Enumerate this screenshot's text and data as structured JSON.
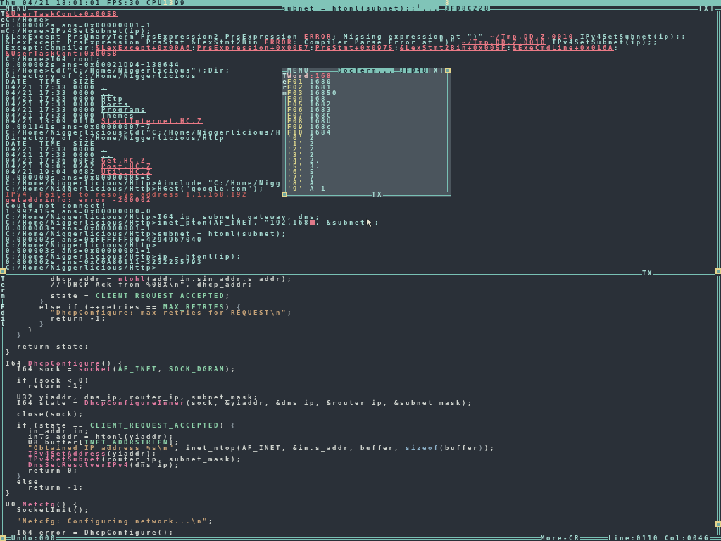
{
  "top_bar": {
    "clock": "Thu 04/21 18:01:01",
    "fps": "FPS:30",
    "cpu_label": "CPU",
    "cpu_cores": [
      {
        "value": "13",
        "color": "#f4e4b4"
      },
      {
        "value": "99",
        "color": "#1c2830"
      }
    ],
    "indicator": "8"
  },
  "terminal": {
    "menu": "MENU",
    "title": "subnet = htonl(subnet);;└...",
    "task_id": "3FD8C228",
    "close": "[X]",
    "side_label": "Term",
    "footer": "TX",
    "lines": [
      {
        "parts": [
          {
            "text": "&UserTaskCont+0x005B",
            "kind": "link"
          }
        ]
      },
      {
        "parts": [
          {
            "text": "C:/Home>",
            "kind": "text"
          }
        ]
      },
      {
        "parts": [
          {
            "text": "0.000002s ans=0x00000001=1",
            "kind": "text"
          }
        ]
      },
      {
        "parts": [
          {
            "text": "C:/Home>IPv4SetSubnet(ip);",
            "kind": "text"
          }
        ]
      },
      {
        "parts": [
          {
            "text": "&LexExcept PrsUnaryTerm PrsExpression2 PrsExpression ",
            "kind": "text"
          },
          {
            "text": "ERROR",
            "kind": "error"
          },
          {
            "text": ": Missing expression at \")\" ",
            "kind": "text"
          },
          {
            "text": "~/Tmp.DD.Z.0010",
            "kind": "link"
          },
          {
            "text": " IPv4SetSubnet(ip);;",
            "kind": "text"
          }
        ]
      },
      {
        "parts": [
          {
            "text": "&LexExcept PrsExpression PrsStmt &LexStmt2Bin ",
            "kind": "text"
          },
          {
            "text": "ERROR",
            "kind": "error"
          },
          {
            "text": ": Compiler Parse Error at \")\" ",
            "kind": "text"
          },
          {
            "text": "~/Tmp.DD.Z.0010",
            "kind": "link"
          },
          {
            "text": " IPv4SetSubnet(ip);;",
            "kind": "text"
          }
        ]
      },
      {
        "parts": [
          {
            "text": "Except:Compiler:",
            "kind": "text"
          },
          {
            "text": "&LexExcept+0x00A6",
            "kind": "link"
          },
          {
            "text": ":",
            "kind": "text"
          },
          {
            "text": "PrsExpression+0x00E7",
            "kind": "link"
          },
          {
            "text": ":",
            "kind": "text"
          },
          {
            "text": "PrsStmt+0x0975",
            "kind": "link"
          },
          {
            "text": ":",
            "kind": "text"
          },
          {
            "text": "&LexStmt2Bin+0x005F",
            "kind": "link"
          },
          {
            "text": ":",
            "kind": "text"
          },
          {
            "text": "&ExeCmdLine+0x016A",
            "kind": "link"
          },
          {
            "text": ":",
            "kind": "text"
          }
        ]
      },
      {
        "parts": [
          {
            "text": "&UserTaskCont+0x005B",
            "kind": "link"
          }
        ]
      },
      {
        "parts": [
          {
            "text": "C:/Home>I64 rout;",
            "kind": "text"
          }
        ]
      },
      {
        "parts": [
          {
            "text": "0.000002s ans=0x00021D94=138644",
            "kind": "text"
          }
        ]
      },
      {
        "parts": [
          {
            "text": "C:/Home>Cd(\"C:/Home/Niggerlicious\");Dir;",
            "kind": "text"
          }
        ]
      },
      {
        "parts": [
          {
            "text": "Directory of C:/Home/Niggerlicious",
            "kind": "text"
          }
        ]
      },
      {
        "parts": [
          {
            "text": "DATE_ TIME_ SIZE",
            "kind": "text"
          }
        ]
      },
      {
        "parts": [
          {
            "text": "04/21 17:33 0000 ",
            "kind": "text"
          },
          {
            "text": ".",
            "kind": "dir"
          }
        ]
      },
      {
        "parts": [
          {
            "text": "04/21 17:33 0000 ",
            "kind": "text"
          },
          {
            "text": "..",
            "kind": "dir"
          }
        ]
      },
      {
        "parts": [
          {
            "text": "04/21 17:33 0000 ",
            "kind": "text"
          },
          {
            "text": "Http",
            "kind": "dir"
          }
        ]
      },
      {
        "parts": [
          {
            "text": "04/21 17:33 0000 ",
            "kind": "text"
          },
          {
            "text": "Ports",
            "kind": "dir"
          }
        ]
      },
      {
        "parts": [
          {
            "text": "04/21 17:33 0000 ",
            "kind": "text"
          },
          {
            "text": "Programs",
            "kind": "dir"
          }
        ]
      },
      {
        "parts": [
          {
            "text": "04/21 17:33 0000 ",
            "kind": "text"
          },
          {
            "text": "Themes",
            "kind": "dir"
          }
        ]
      },
      {
        "parts": [
          {
            "text": "04/21 13:09 011D ",
            "kind": "text"
          },
          {
            "text": "StartInternet.HC.Z",
            "kind": "link"
          }
        ]
      },
      {
        "parts": [
          {
            "text": "0.001141s ans=0x00000007=7",
            "kind": "text"
          }
        ]
      },
      {
        "parts": [
          {
            "text": "C:/Home/Niggerlicious>Cd(\"C:/Home/Niggerlicious/H",
            "kind": "text"
          }
        ]
      },
      {
        "parts": [
          {
            "text": "Directory of C:/Home/Niggerlicious/Http",
            "kind": "text"
          }
        ]
      },
      {
        "parts": [
          {
            "text": "DATE_ TIME_ SIZE",
            "kind": "text"
          }
        ]
      },
      {
        "parts": [
          {
            "text": "04/21 17:33 0000 ",
            "kind": "text"
          },
          {
            "text": ".",
            "kind": "dir"
          }
        ]
      },
      {
        "parts": [
          {
            "text": "04/21 17:33 0000 ",
            "kind": "text"
          },
          {
            "text": "..",
            "kind": "dir"
          }
        ]
      },
      {
        "parts": [
          {
            "text": "04/21 17:36 00F3 ",
            "kind": "text"
          },
          {
            "text": "Get.HC.Z",
            "kind": "link"
          }
        ]
      },
      {
        "parts": [
          {
            "text": "04/21 19:05 02A2 ",
            "kind": "text"
          },
          {
            "text": "Post.HC.Z",
            "kind": "link"
          }
        ]
      },
      {
        "parts": [
          {
            "text": "04/21 19:04 0682 ",
            "kind": "text"
          },
          {
            "text": "Util.HC.Z",
            "kind": "link"
          }
        ]
      },
      {
        "parts": [
          {
            "text": "0.000900s ans=0x00000005=5",
            "kind": "text"
          }
        ]
      },
      {
        "parts": [
          {
            "text": "C:/Home/Niggerlicious/Http>#include \"C:/Home/Nigg",
            "kind": "text"
          }
        ]
      },
      {
        "parts": [
          {
            "text": "C:/Home/Niggerlicious/Http>HGet(\"google.com\");",
            "kind": "text"
          }
        ]
      },
      {
        "parts": [
          {
            "text": "IPv4: Failed to resolve address 1.1.168.192",
            "kind": "warn"
          }
        ]
      },
      {
        "parts": [
          {
            "text": "getaddrinfo: error -200002",
            "kind": "error"
          }
        ]
      },
      {
        "parts": [
          {
            "text": "Could not connect!",
            "kind": "text"
          }
        ]
      },
      {
        "parts": [
          {
            "text": "1.997415s ans=0x00000000=0",
            "kind": "text"
          }
        ]
      },
      {
        "parts": [
          {
            "text": "C:/Home/Niggerlicious/Http>I64 ip, subnet, gateway, dns;",
            "kind": "text"
          }
        ]
      },
      {
        "parts": [
          {
            "text": "C:/Home/Niggerlicious/Http>inet_pton(AF_INET, \"192.168",
            "kind": "text"
          },
          {
            "kind": "cursor"
          },
          {
            "text": ", &subnet",
            "kind": "text"
          },
          {
            "kind": "pointer"
          },
          {
            "text": ";",
            "kind": "text"
          }
        ]
      },
      {
        "parts": [
          {
            "text": "0.000003s ans=0x00000001=1",
            "kind": "text"
          }
        ]
      },
      {
        "parts": [
          {
            "text": "C:/Home/Niggerlicious/Http>subnet = htonl(subnet);",
            "kind": "text"
          }
        ]
      },
      {
        "parts": [
          {
            "text": "0.000002s ans=0xFFFFFF00=4294967040",
            "kind": "text"
          }
        ]
      },
      {
        "parts": [
          {
            "text": "C:/Home/Niggerlicious/Http>",
            "kind": "text"
          }
        ]
      },
      {
        "parts": [
          {
            "text": "0.000003s ans=0x00000001=1",
            "kind": "text"
          }
        ]
      },
      {
        "parts": [
          {
            "text": "C:/Home/Niggerlicious/Http>ip = htonl(ip);",
            "kind": "text"
          }
        ]
      },
      {
        "parts": [
          {
            "text": "0.000002s ans=0xC0A80111=3232235793",
            "kind": "text"
          }
        ]
      },
      {
        "parts": [
          {
            "text": "C:/Home/Niggerlicious/Http>",
            "kind": "text"
          }
        ]
      }
    ]
  },
  "doc_popup": {
    "menu": "MENU",
    "title": "DocTerm...",
    "task_id": "3FD48",
    "close": "[X]",
    "side_label": "Term",
    "footer": "TX",
    "word": {
      "label": "Word",
      "value": ":168"
    },
    "rows": [
      {
        "key": "F01",
        "value": "1680"
      },
      {
        "key": "F02",
        "value": "1681"
      },
      {
        "key": "F03",
        "value": "16850"
      },
      {
        "key": "F04",
        "value": "168"
      },
      {
        "key": "F05",
        "value": "1682"
      },
      {
        "key": "F06",
        "value": "1683"
      },
      {
        "key": "F07",
        "value": "168C"
      },
      {
        "key": "F08",
        "value": "168U"
      },
      {
        "key": "F09",
        "value": "168c"
      },
      {
        "key": "F10",
        "value": "1684"
      },
      {
        "key": "'0'",
        "value": "2"
      },
      {
        "key": "'1'",
        "value": "2"
      },
      {
        "key": "'2'",
        "value": "2"
      },
      {
        "key": "'3'",
        "value": "2"
      },
      {
        "key": "'4'",
        "value": "2."
      },
      {
        "key": "'5'",
        "value": "3."
      },
      {
        "key": "'6'",
        "value": "5"
      },
      {
        "key": "'7'",
        "value": "7"
      },
      {
        "key": "'8'",
        "value": "A"
      },
      {
        "key": "'9'",
        "value": "A 1"
      }
    ]
  },
  "editor": {
    "side_labels": [
      "Term",
      "Edit"
    ],
    "lines": [
      {
        "kind": "code",
        "parts": [
          {
            "text": "        dhcp_addr = ",
            "kind": "plain"
          },
          {
            "text": "ntohl",
            "kind": "func"
          },
          {
            "text": "(addr_in.sin_addr.s_addr);",
            "kind": "plain"
          }
        ]
      },
      {
        "kind": "code",
        "parts": [
          {
            "text": "        //\"DHCP Ack from %08X\\n\", dhcp_addr;",
            "kind": "plain"
          }
        ]
      },
      {
        "kind": "blank"
      },
      {
        "kind": "code",
        "parts": [
          {
            "text": "        state = ",
            "kind": "plain"
          },
          {
            "text": "CLIENT_REQUEST_ACCEPTED",
            "kind": "const"
          },
          {
            "text": ";",
            "kind": "plain"
          }
        ]
      },
      {
        "kind": "code",
        "parts": [
          {
            "text": "      }",
            "kind": "dim"
          }
        ]
      },
      {
        "kind": "code",
        "parts": [
          {
            "text": "      else if (++retries == ",
            "kind": "plain"
          },
          {
            "text": "MAX_RETRIES",
            "kind": "const"
          },
          {
            "text": ") ",
            "kind": "plain"
          },
          {
            "text": "{",
            "kind": "dim"
          }
        ]
      },
      {
        "kind": "code",
        "parts": [
          {
            "text": "        \"DhcpConfigure: max retries for REQUEST\\n\"",
            "kind": "string"
          },
          {
            "text": ";",
            "kind": "plain"
          }
        ]
      },
      {
        "kind": "code",
        "parts": [
          {
            "text": "        return -1;",
            "kind": "plain"
          }
        ]
      },
      {
        "kind": "code",
        "parts": [
          {
            "text": "      }",
            "kind": "dim"
          }
        ]
      },
      {
        "kind": "code",
        "parts": [
          {
            "text": "    }",
            "kind": "plain"
          }
        ]
      },
      {
        "kind": "code",
        "parts": [
          {
            "text": "  }",
            "kind": "dim"
          }
        ]
      },
      {
        "kind": "blank"
      },
      {
        "kind": "code",
        "parts": [
          {
            "text": "  return state;",
            "kind": "plain"
          }
        ]
      },
      {
        "kind": "code",
        "parts": [
          {
            "text": "}",
            "kind": "plain"
          }
        ]
      },
      {
        "kind": "blank"
      },
      {
        "kind": "code",
        "parts": [
          {
            "text": "I64 ",
            "kind": "plain"
          },
          {
            "text": "DhcpConfigure",
            "kind": "func"
          },
          {
            "text": "() {",
            "kind": "plain"
          }
        ]
      },
      {
        "kind": "code",
        "parts": [
          {
            "text": "  I64 sock = ",
            "kind": "plain"
          },
          {
            "text": "socket",
            "kind": "func"
          },
          {
            "text": "(",
            "kind": "plain"
          },
          {
            "text": "AF_INET",
            "kind": "const"
          },
          {
            "text": ", ",
            "kind": "plain"
          },
          {
            "text": "SOCK_DGRAM",
            "kind": "const"
          },
          {
            "text": ");",
            "kind": "plain"
          }
        ]
      },
      {
        "kind": "blank"
      },
      {
        "kind": "code",
        "parts": [
          {
            "text": "  if (sock < 0)",
            "kind": "plain"
          }
        ]
      },
      {
        "kind": "code",
        "parts": [
          {
            "text": "    return -1;",
            "kind": "plain"
          }
        ]
      },
      {
        "kind": "blank"
      },
      {
        "kind": "code",
        "parts": [
          {
            "text": "  U32 yiaddr, dns_ip, router_ip, subnet_mask;",
            "kind": "plain"
          }
        ]
      },
      {
        "kind": "code",
        "parts": [
          {
            "text": "  I64 state = ",
            "kind": "plain"
          },
          {
            "text": "DhcpConfigureInner",
            "kind": "func"
          },
          {
            "text": "(sock, &yiaddr, &dns_ip, &router_ip, &subnet_mask);",
            "kind": "plain"
          }
        ]
      },
      {
        "kind": "blank"
      },
      {
        "kind": "code",
        "parts": [
          {
            "text": "  close(sock);",
            "kind": "plain"
          }
        ]
      },
      {
        "kind": "blank"
      },
      {
        "kind": "code",
        "parts": [
          {
            "text": "  if (state == ",
            "kind": "plain"
          },
          {
            "text": "CLIENT_REQUEST_ACCEPTED",
            "kind": "const"
          },
          {
            "text": ") ",
            "kind": "plain"
          },
          {
            "text": "{",
            "kind": "dim"
          }
        ]
      },
      {
        "kind": "code",
        "parts": [
          {
            "text": "    in_addr in;",
            "kind": "plain"
          }
        ]
      },
      {
        "kind": "code",
        "parts": [
          {
            "text": "    in.s_addr = htonl(yiaddr);",
            "kind": "plain"
          }
        ]
      },
      {
        "kind": "code",
        "parts": [
          {
            "text": "    U8 buffer[",
            "kind": "plain"
          },
          {
            "text": "INET_ADDRSTRLEN",
            "kind": "const"
          },
          {
            "text": "];",
            "kind": "plain"
          }
        ]
      },
      {
        "kind": "code",
        "parts": [
          {
            "text": "    \"Obtained IP address %s\\n\"",
            "kind": "string"
          },
          {
            "text": ", inet_ntop(AF_INET, &in.s_addr, buffer, ",
            "kind": "plain"
          },
          {
            "text": "sizeof",
            "kind": "keyword"
          },
          {
            "text": "(",
            "kind": "dim"
          },
          {
            "text": "buffer",
            "kind": "plain"
          },
          {
            "text": ")",
            "kind": "dim"
          },
          {
            "text": ");",
            "kind": "plain"
          }
        ]
      },
      {
        "kind": "code",
        "parts": [
          {
            "text": "    IPv4SetAddress",
            "kind": "func"
          },
          {
            "text": "(yiaddr);",
            "kind": "plain"
          }
        ]
      },
      {
        "kind": "code",
        "parts": [
          {
            "text": "    IPv4SetSubnet",
            "kind": "func"
          },
          {
            "text": "(router_ip, subnet_mask);",
            "kind": "plain"
          }
        ]
      },
      {
        "kind": "code",
        "parts": [
          {
            "text": "    DnsSetResolverIPv4",
            "kind": "func"
          },
          {
            "text": "(dns_ip);",
            "kind": "plain"
          }
        ]
      },
      {
        "kind": "code",
        "parts": [
          {
            "text": "    return 0;",
            "kind": "plain"
          }
        ]
      },
      {
        "kind": "code",
        "parts": [
          {
            "text": "  }",
            "kind": "dim"
          }
        ]
      },
      {
        "kind": "code",
        "parts": [
          {
            "text": "  else",
            "kind": "plain"
          }
        ]
      },
      {
        "kind": "code",
        "parts": [
          {
            "text": "    return -1;",
            "kind": "plain"
          }
        ]
      },
      {
        "kind": "code",
        "parts": [
          {
            "text": "}",
            "kind": "plain"
          }
        ]
      },
      {
        "kind": "blank"
      },
      {
        "kind": "code",
        "parts": [
          {
            "text": "U0 ",
            "kind": "plain"
          },
          {
            "text": "Netcfg",
            "kind": "func"
          },
          {
            "text": "() {",
            "kind": "plain"
          }
        ]
      },
      {
        "kind": "code",
        "parts": [
          {
            "text": "  SocketInit();",
            "kind": "plain"
          }
        ]
      },
      {
        "kind": "blank"
      },
      {
        "kind": "code",
        "parts": [
          {
            "text": "  \"Netcfg: Configuring network...\\n\"",
            "kind": "string"
          },
          {
            "text": ";",
            "kind": "plain"
          }
        ]
      },
      {
        "kind": "blank"
      },
      {
        "kind": "code",
        "parts": [
          {
            "text": "  I64 error = DhcpConfigure();",
            "kind": "plain"
          }
        ]
      }
    ],
    "status": {
      "undo": "Undo:000",
      "more": "More-CR",
      "position": "Line:0110 Col:0046"
    }
  }
}
